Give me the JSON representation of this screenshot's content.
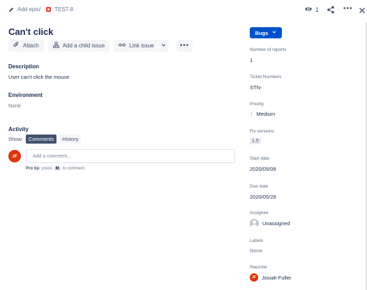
{
  "breadcrumb": {
    "epic_label": "Add epic",
    "separator": "/",
    "issue_key": "TEST-8"
  },
  "header": {
    "watch_count": "1"
  },
  "issue": {
    "title": "Can't click"
  },
  "actions": {
    "attach": "Attach",
    "add_child": "Add a child issue",
    "link_issue": "Link issue"
  },
  "description": {
    "heading": "Description",
    "text": "User can't click the mouse"
  },
  "environment": {
    "heading": "Environment",
    "value": "None"
  },
  "activity": {
    "heading": "Activity",
    "show_label": "Show:",
    "tabs": [
      "Comments",
      "History"
    ],
    "avatar_initials": "JF",
    "comment_placeholder": "Add a comment...",
    "protip_bold": "Pro tip:",
    "protip_pre": "press",
    "protip_key": "M",
    "protip_post": "to comment"
  },
  "sidebar": {
    "status": "Bugs",
    "number_of_reports_label": "Number of reports",
    "number_of_reports": "1",
    "ticket_numbers_label": "Ticket Numbers",
    "ticket_numbers": "STN-",
    "priority_label": "Priority",
    "priority": "Medium",
    "fix_versions_label": "Fix versions",
    "fix_version": "1.5",
    "start_date_label": "Start date",
    "start_date": "2020/05/09",
    "due_date_label": "Due date",
    "due_date": "2020/05/29",
    "assignee_label": "Assignee",
    "assignee": "Unassigned",
    "labels_label": "Labels",
    "labels": "None",
    "reporter_label": "Reporter",
    "reporter": "Josiah Fuller",
    "reporter_initials": "JF"
  },
  "colors": {
    "primary": "#0052cc",
    "bug": "#e5493a",
    "avatar": "#de350b",
    "priority_medium": "#ff7452"
  }
}
